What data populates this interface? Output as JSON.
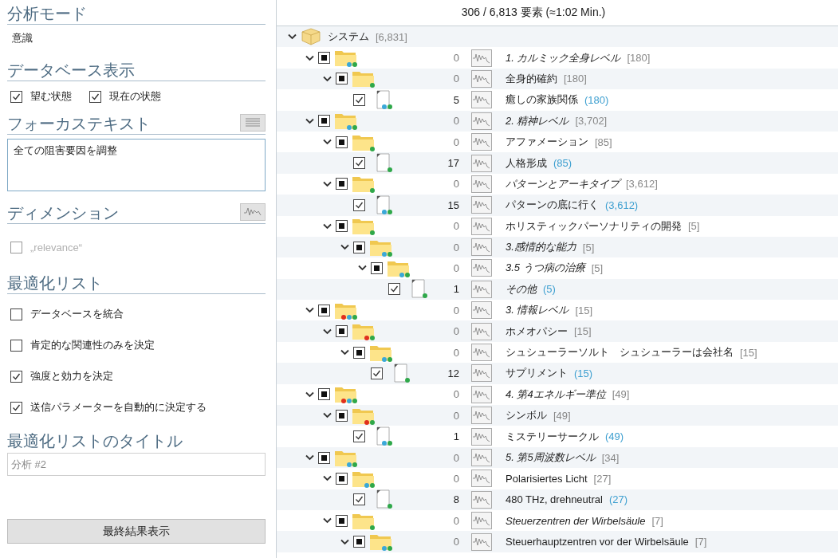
{
  "sidebar": {
    "analysis_mode": {
      "title": "分析モード",
      "value": "意識"
    },
    "database_view": {
      "title": "データベース表示",
      "options": [
        {
          "label": "望む状態",
          "checked": true
        },
        {
          "label": "現在の状態",
          "checked": true
        }
      ]
    },
    "focus_text": {
      "title": "フォーカステキスト",
      "value": "全ての阻害要因を調整"
    },
    "dimension": {
      "title": "ディメンション",
      "options": [
        {
          "label": "„relevance“",
          "checked": false,
          "disabled": true
        }
      ]
    },
    "optimization_list": {
      "title": "最適化リスト",
      "options": [
        {
          "label": "データベースを統合",
          "checked": false
        },
        {
          "label": "肯定的な関連性のみを決定",
          "checked": false
        },
        {
          "label": "強度と効力を決定",
          "checked": true
        },
        {
          "label": "送信パラメーターを自動的に決定する",
          "checked": true
        }
      ]
    },
    "list_title": {
      "title": "最適化リストのタイトル",
      "placeholder": "分析 #2"
    },
    "buttons": [
      "最終結果表示"
    ]
  },
  "status": "306 / 6,813 要素 (≈1:02 Min.)",
  "tree": {
    "label": "システム",
    "count": "[6,831]",
    "expanded": true,
    "children": [
      {
        "kind": "folder",
        "mixed": true,
        "expanded": true,
        "score": "0",
        "label": "1. カルミック全身レベル",
        "italic": true,
        "count": "[180]",
        "dots": [
          {
            "color": "#3aa8d8"
          },
          {
            "color": "#2fa84a"
          }
        ],
        "children": [
          {
            "kind": "folder",
            "mixed": true,
            "expanded": true,
            "score": "0",
            "label": "全身的確約",
            "italic": false,
            "count": "[180]",
            "dots": [
              {
                "color": "#2fa84a"
              }
            ],
            "children": [
              {
                "kind": "file",
                "checked": true,
                "score": "5",
                "label": "癒しの家族関係",
                "italic": false,
                "count": "(180)",
                "dots": [
                  {
                    "color": "#3aa8d8"
                  },
                  {
                    "color": "#2fa84a"
                  }
                ]
              }
            ]
          }
        ]
      },
      {
        "kind": "folder",
        "mixed": true,
        "expanded": true,
        "score": "0",
        "label": "2. 精神レベル",
        "italic": true,
        "count": "[3,702]",
        "dots": [
          {
            "color": "#3aa8d8"
          },
          {
            "color": "#2fa84a"
          }
        ],
        "children": [
          {
            "kind": "folder",
            "mixed": true,
            "expanded": true,
            "score": "0",
            "label": "アファメーション",
            "italic": false,
            "count": "[85]",
            "dots": [
              {
                "color": "#2fa84a"
              }
            ],
            "children": [
              {
                "kind": "file",
                "checked": true,
                "score": "17",
                "label": "人格形成",
                "italic": false,
                "count": "(85)",
                "dots": [
                  {
                    "color": "#2fa84a"
                  }
                ]
              }
            ]
          },
          {
            "kind": "folder",
            "mixed": true,
            "expanded": true,
            "score": "0",
            "label": "パターンとアーキタイプ",
            "italic": true,
            "count": "[3,612]",
            "dots": [
              {
                "color": "#2fa84a"
              }
            ],
            "children": [
              {
                "kind": "file",
                "checked": true,
                "score": "15",
                "label": "パターンの底に行く",
                "italic": false,
                "count": "(3,612)",
                "dots": [
                  {
                    "color": "#3aa8d8"
                  },
                  {
                    "color": "#2fa84a"
                  }
                ]
              }
            ]
          },
          {
            "kind": "folder",
            "mixed": true,
            "expanded": true,
            "score": "0",
            "label": "ホリスティックパーソナリティの開発",
            "italic": false,
            "count": "[5]",
            "dots": [
              {
                "color": "#2fa84a"
              }
            ],
            "children": [
              {
                "kind": "folder",
                "mixed": true,
                "expanded": true,
                "score": "0",
                "label": "3.感情的な能力",
                "italic": true,
                "count": "[5]",
                "dots": [
                  {
                    "color": "#3aa8d8"
                  },
                  {
                    "color": "#2fa84a"
                  }
                ],
                "children": [
                  {
                    "kind": "folder",
                    "mixed": true,
                    "expanded": true,
                    "score": "0",
                    "label": "3.5 うつ病の治療",
                    "italic": true,
                    "count": "[5]",
                    "dots": [
                      {
                        "color": "#3aa8d8"
                      },
                      {
                        "color": "#2fa84a"
                      }
                    ],
                    "children": [
                      {
                        "kind": "file",
                        "checked": true,
                        "score": "1",
                        "label": "その他",
                        "italic": true,
                        "count": "(5)",
                        "dots": [
                          {
                            "color": "#2fa84a"
                          }
                        ]
                      }
                    ]
                  }
                ]
              }
            ]
          }
        ]
      },
      {
        "kind": "folder",
        "mixed": true,
        "expanded": true,
        "score": "0",
        "label": "3. 情報レベル",
        "italic": true,
        "count": "[15]",
        "dots": [
          {
            "color": "#e0301e"
          },
          {
            "color": "#3aa8d8"
          },
          {
            "color": "#2fa84a"
          }
        ],
        "children": [
          {
            "kind": "folder",
            "mixed": true,
            "expanded": true,
            "score": "0",
            "label": "ホメオパシー",
            "italic": false,
            "count": "[15]",
            "dots": [
              {
                "color": "#e0301e"
              },
              {
                "color": "#2fa84a"
              }
            ],
            "children": [
              {
                "kind": "folder",
                "mixed": true,
                "expanded": true,
                "score": "0",
                "label": "シュシューラーソルト　シュシューラーは会社名",
                "italic": false,
                "count": "[15]",
                "dots": [
                  {
                    "color": "#3aa8d8"
                  },
                  {
                    "color": "#2fa84a"
                  }
                ],
                "children": [
                  {
                    "kind": "file",
                    "checked": true,
                    "score": "12",
                    "label": "サプリメント",
                    "italic": false,
                    "count": "(15)",
                    "dots": [
                      {
                        "color": "#2fa84a"
                      }
                    ]
                  }
                ]
              }
            ]
          }
        ]
      },
      {
        "kind": "folder",
        "mixed": true,
        "expanded": true,
        "score": "0",
        "label": "4. 第4エネルギー準位",
        "italic": true,
        "count": "[49]",
        "dots": [
          {
            "color": "#e0301e"
          },
          {
            "color": "#3aa8d8"
          },
          {
            "color": "#2fa84a"
          }
        ],
        "children": [
          {
            "kind": "folder",
            "mixed": true,
            "expanded": true,
            "score": "0",
            "label": "シンボル",
            "italic": false,
            "count": "[49]",
            "dots": [
              {
                "color": "#e0301e"
              },
              {
                "color": "#2fa84a"
              }
            ],
            "children": [
              {
                "kind": "file",
                "checked": true,
                "score": "1",
                "label": "ミステリーサークル",
                "italic": false,
                "count": "(49)",
                "dots": [
                  {
                    "color": "#3aa8d8"
                  },
                  {
                    "color": "#2fa84a"
                  }
                ]
              }
            ]
          }
        ]
      },
      {
        "kind": "folder",
        "mixed": true,
        "expanded": true,
        "score": "0",
        "label": "5. 第5周波数レベル",
        "italic": true,
        "count": "[34]",
        "dots": [
          {
            "color": "#3aa8d8"
          },
          {
            "color": "#2fa84a"
          }
        ],
        "children": [
          {
            "kind": "folder",
            "mixed": true,
            "expanded": true,
            "score": "0",
            "label": "Polarisiertes Licht",
            "italic": false,
            "count": "[27]",
            "dots": [
              {
                "color": "#3aa8d8"
              },
              {
                "color": "#2fa84a"
              }
            ],
            "children": [
              {
                "kind": "file",
                "checked": true,
                "score": "8",
                "label": "480 THz, drehneutral",
                "italic": false,
                "count": "(27)",
                "dots": [
                  {
                    "color": "#2fa84a"
                  }
                ]
              }
            ]
          },
          {
            "kind": "folder",
            "mixed": true,
            "expanded": true,
            "score": "0",
            "label": "Steuerzentren der Wirbelsäule",
            "italic": true,
            "count": "[7]",
            "dots": [
              {
                "color": "#2fa84a"
              }
            ],
            "children": [
              {
                "kind": "folder",
                "mixed": true,
                "expanded": true,
                "score": "0",
                "label": "Steuerhauptzentren vor der Wirbelsäule",
                "italic": false,
                "count": "[7]",
                "dots": [
                  {
                    "color": "#3aa8d8"
                  },
                  {
                    "color": "#2fa84a"
                  }
                ]
              }
            ]
          }
        ]
      }
    ]
  }
}
